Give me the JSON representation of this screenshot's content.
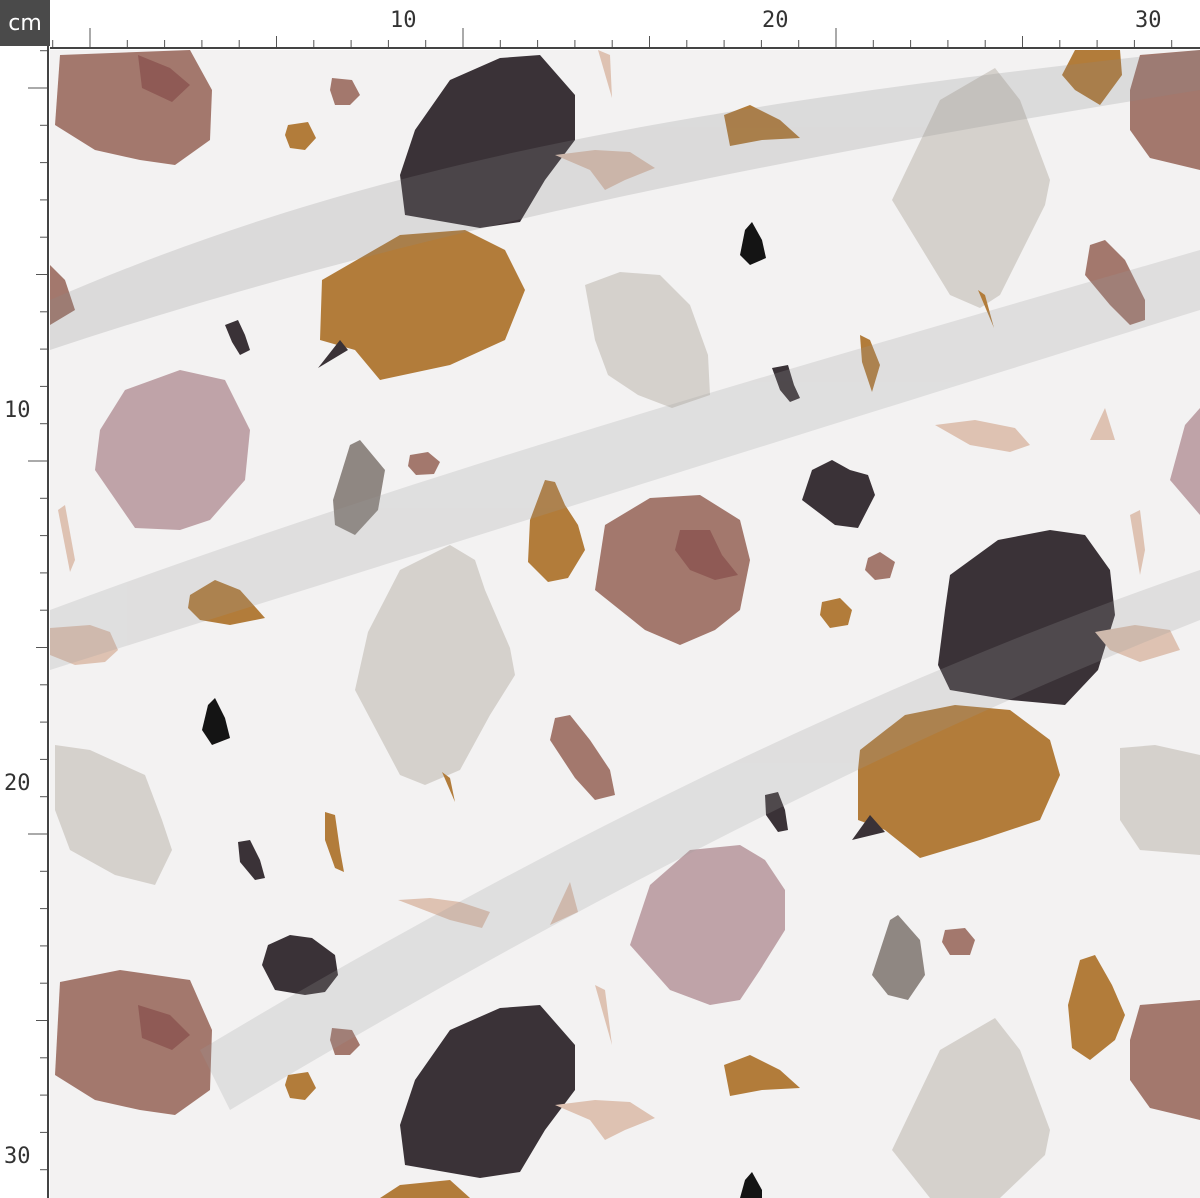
{
  "ruler": {
    "unit": "cm",
    "top_labels": [
      "10",
      "20",
      "30"
    ],
    "left_labels": [
      "10",
      "20",
      "30"
    ]
  },
  "fabric": {
    "pattern": "terrazzo",
    "background_color": "#f3f2f2",
    "palette": {
      "charcoal": "#3a3237",
      "mustard": "#b27c3a",
      "rose_brown": "#a3786d",
      "mauve": "#bfa3a8",
      "stone": "#d5d1cc",
      "taupe": "#8f8782",
      "blush": "#dec2b2",
      "black": "#141414"
    }
  }
}
